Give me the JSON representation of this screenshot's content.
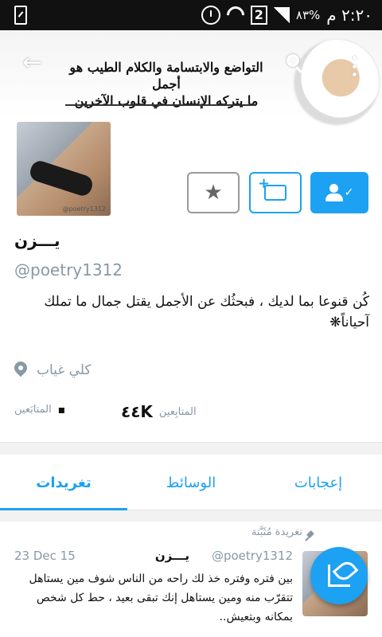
{
  "status_bar": {
    "battery": "٨٣%",
    "time": "٢:٢٠ م",
    "sim": "2"
  },
  "header": {
    "banner_line1": "التواضع والابتسامة والكلام الطيب هو أجمل",
    "banner_line2": "ما يتركه الإنسان في قلوب الآخرين"
  },
  "profile": {
    "name": "يـــزن",
    "handle": "@poetry1312",
    "bio": "كُن قنوعا بما لديك ، فبحثُك عن الأجمل يقتل جمال ما تملك آحياناً❋",
    "location": "كلي غياب",
    "avatar_tag": "@poetry1312",
    "followers_value": "٤٤K",
    "followers_label": "المتابِعين",
    "following_value": "▪",
    "following_label": "المتابَعين"
  },
  "tabs": [
    {
      "label": "تغريدات",
      "active": true
    },
    {
      "label": "الوسائط",
      "active": false
    },
    {
      "label": "إعجابات",
      "active": false
    }
  ],
  "tweet": {
    "pinned_label": "تغريدة مُثَبَّتة",
    "name": "يـــزن",
    "handle": "@poetry1312",
    "date": "23 Dec 15",
    "text": "بين فتره وفتره خذ لك راحه من الناس  شوف مين يستاهل تتقرّب منه ومين يستاهل إنك تبقى بعيد ، حط كل شخص بمكانه وبتعيش.."
  },
  "colors": {
    "accent": "#1da1f2",
    "muted": "#8899a6",
    "text": "#111111"
  },
  "icons": [
    "back-arrow-icon",
    "search-icon",
    "more-icon",
    "star-icon",
    "message-icon",
    "following-icon",
    "location-icon",
    "pin-icon",
    "compose-icon"
  ]
}
